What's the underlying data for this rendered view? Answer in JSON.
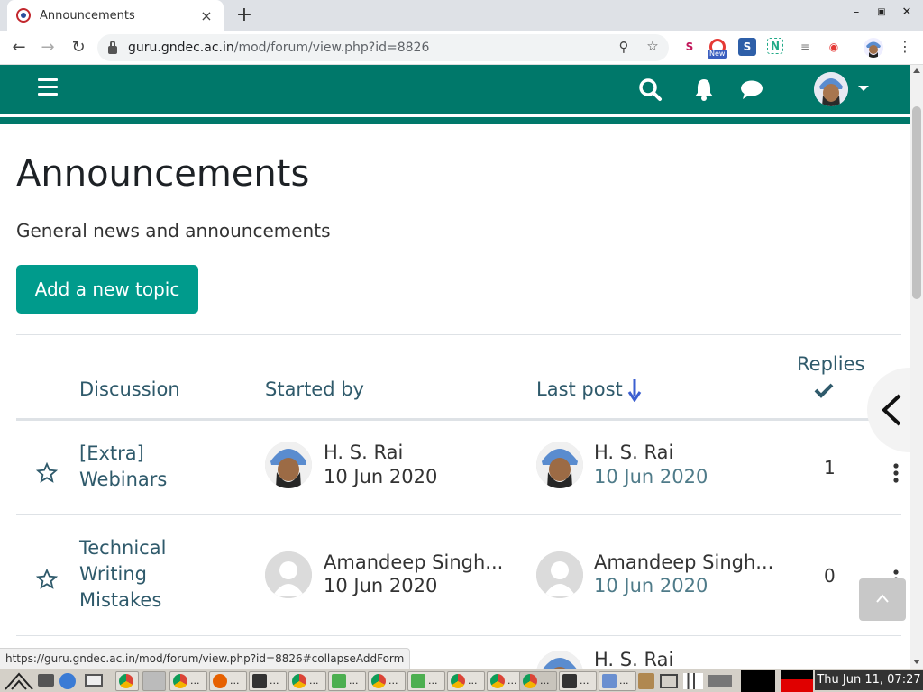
{
  "browser": {
    "tab_title": "Announcements",
    "tab_close": "×",
    "new_tab": "+",
    "url_host": "guru.gndec.ac.in",
    "url_path": "/mod/forum/view.php?id=8826",
    "extension_badge": "New",
    "status_url": "https://guru.gndec.ac.in/mod/forum/view.php?id=8826#collapseAddForm"
  },
  "colors": {
    "navbar": "#00786a",
    "primary_button": "#009b8c",
    "link": "#2f5a6b",
    "sort_arrow": "#3b5fd0"
  },
  "page": {
    "title": "Announcements",
    "intro": "General news and announcements",
    "add_topic_label": "Add a new topic"
  },
  "table": {
    "headers": {
      "discussion": "Discussion",
      "started_by": "Started by",
      "last_post": "Last post",
      "replies": "Replies"
    },
    "rows": [
      {
        "title_lines": [
          "[Extra]",
          "Webinars"
        ],
        "started_by": "H. S. Rai",
        "started_date": "10 Jun 2020",
        "last_post_by": "H. S. Rai",
        "last_post_date": "10 Jun 2020",
        "replies": "1"
      },
      {
        "title_lines": [
          "Technical",
          "Writing",
          "Mistakes"
        ],
        "started_by": "Amandeep Singh...",
        "started_date": "10 Jun 2020",
        "last_post_by": "Amandeep Singh...",
        "last_post_date": "10 Jun 2020",
        "replies": "0"
      },
      {
        "last_post_by": "H. S. Rai"
      }
    ]
  },
  "taskbar": {
    "item_label": "...",
    "clock": "Thu Jun 11, 07:27"
  }
}
